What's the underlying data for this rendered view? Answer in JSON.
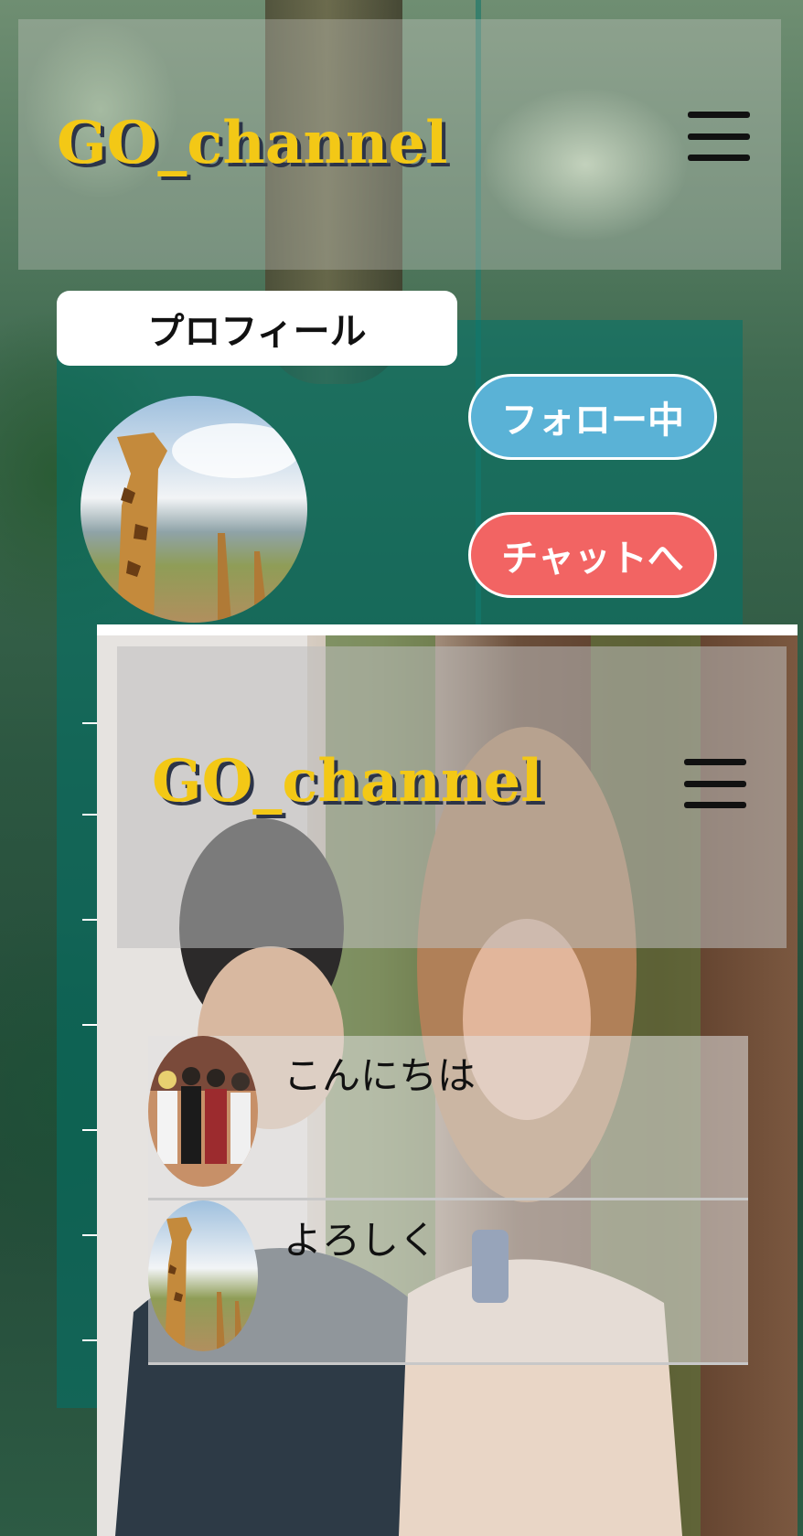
{
  "header": {
    "brand": "GO_channel",
    "menu_icon": "hamburger-icon"
  },
  "profile": {
    "tab_label": "プロフィール",
    "follow_label": "フォロー中",
    "chat_label": "チャットへ",
    "avatar_icon": "giraffe-avatar"
  },
  "chat_screen": {
    "brand": "GO_channel",
    "menu_icon": "hamburger-icon",
    "messages": [
      {
        "text": "こんにちは",
        "avatar": "band-photo-avatar"
      },
      {
        "text": "よろしく",
        "avatar": "giraffe-avatar"
      }
    ]
  },
  "colors": {
    "brand": "#f3c816",
    "follow": "#5ab2d6",
    "chat": "#f26463",
    "panel": "#00736980"
  }
}
